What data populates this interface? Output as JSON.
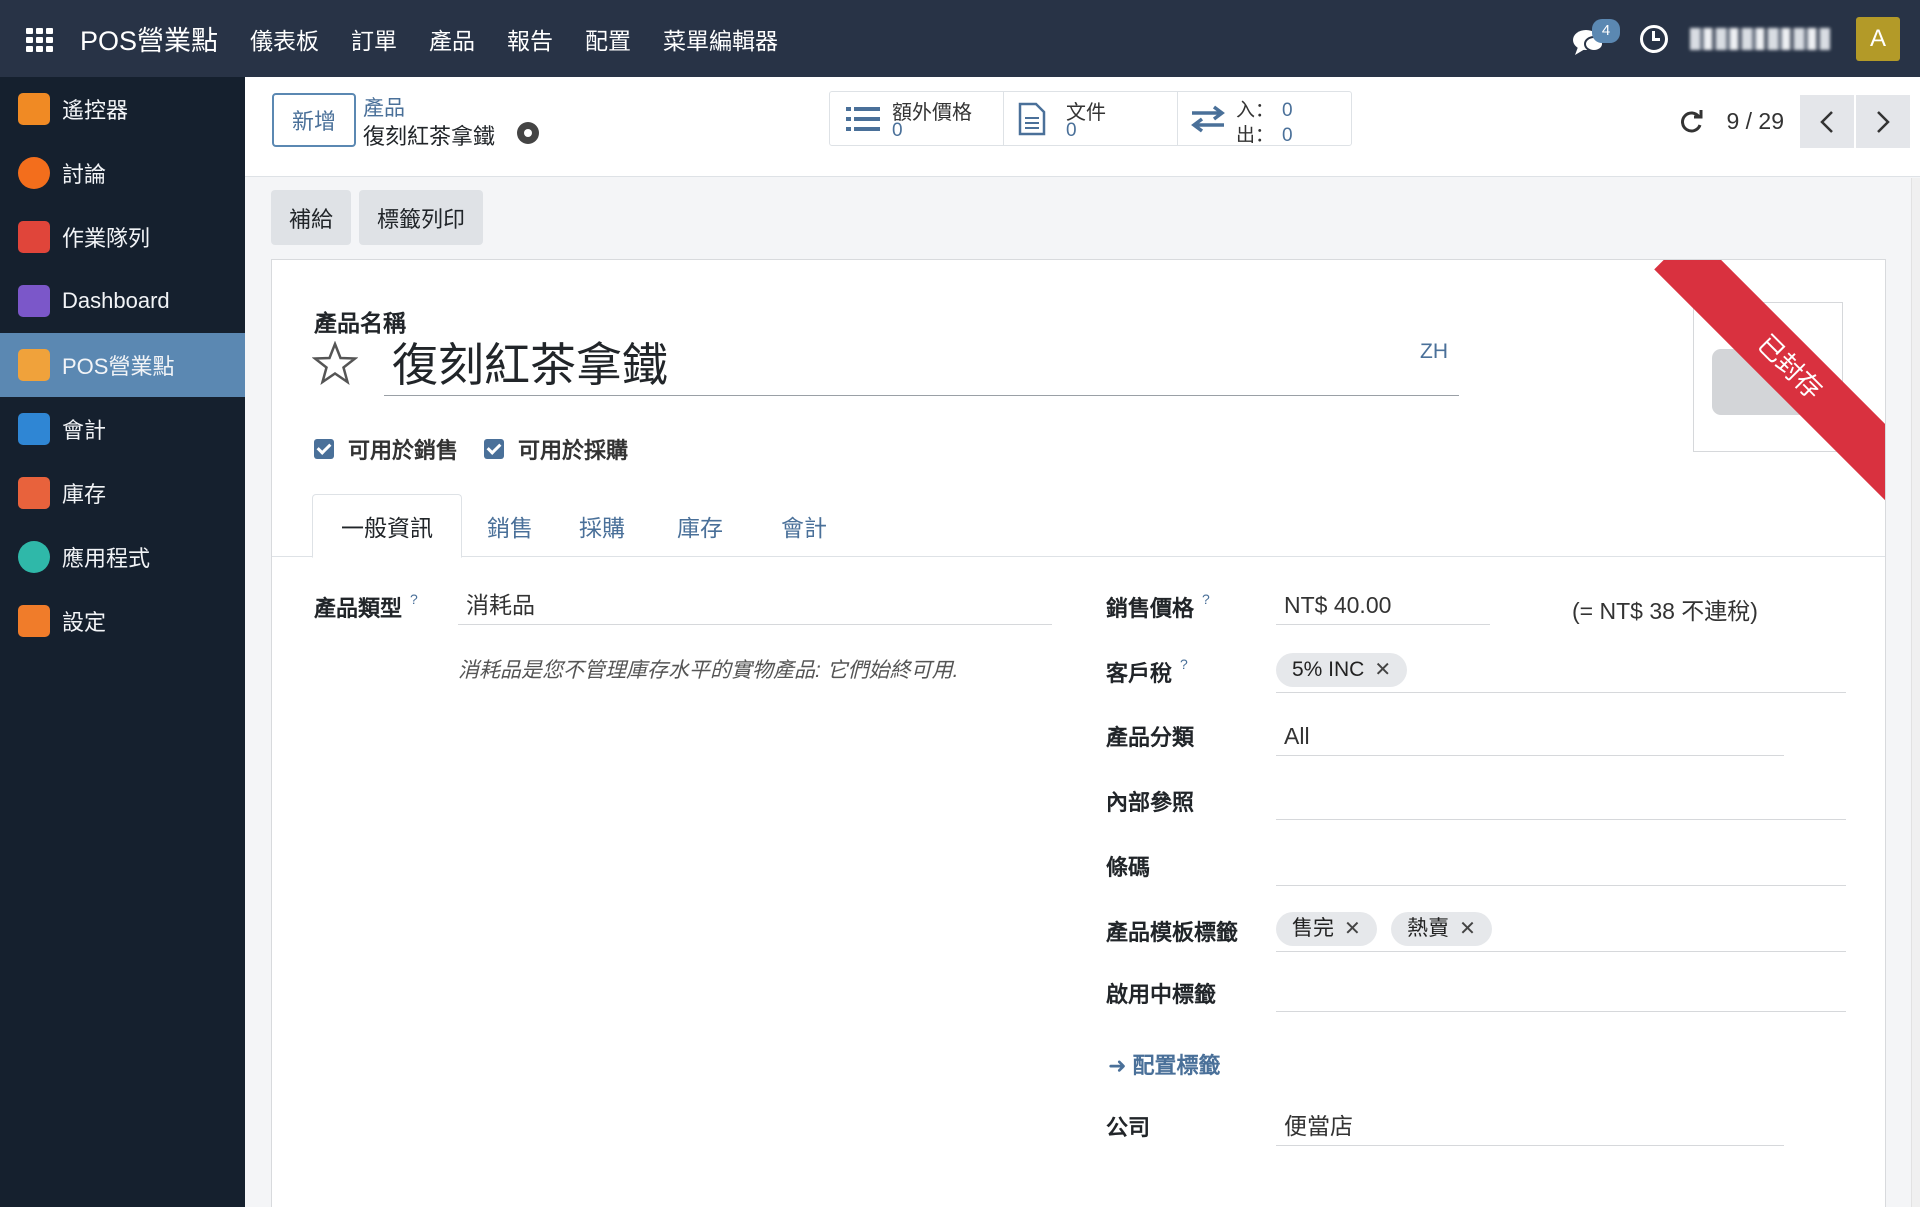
{
  "topbar": {
    "brand": "POS營業點",
    "menu": [
      "儀表板",
      "訂單",
      "產品",
      "報告",
      "配置",
      "菜單編輯器"
    ],
    "chat_count": "4",
    "avatar_letter": "A"
  },
  "sidebar": {
    "items": [
      {
        "label": "遙控器",
        "icon": "remote-icon",
        "color": "#f08a24"
      },
      {
        "label": "討論",
        "icon": "discuss-icon",
        "color": "#f36e1c"
      },
      {
        "label": "作業隊列",
        "icon": "queue-icon",
        "color": "#e0453a"
      },
      {
        "label": "Dashboard",
        "icon": "dashboard-icon",
        "color": "#7b57c9"
      },
      {
        "label": "POS營業點",
        "icon": "pos-icon",
        "color": "#f0a23b"
      },
      {
        "label": "會計",
        "icon": "accounting-icon",
        "color": "#2f86d4"
      },
      {
        "label": "庫存",
        "icon": "inventory-icon",
        "color": "#e8623c"
      },
      {
        "label": "應用程式",
        "icon": "apps-icon",
        "color": "#2fb8a9"
      },
      {
        "label": "設定",
        "icon": "settings-icon",
        "color": "#f07c2a"
      }
    ],
    "active_index": 4
  },
  "control": {
    "new_label": "新增",
    "breadcrumb_parent": "產品",
    "breadcrumb_current": "復刻紅茶拿鐵",
    "stats": {
      "extra_price_label": "額外價格",
      "extra_price_value": "0",
      "documents_label": "文件",
      "documents_value": "0",
      "in_label": "入：",
      "in_value": "0",
      "out_label": "出：",
      "out_value": "0"
    },
    "pager": "9 / 29"
  },
  "actions": {
    "replenish": "補給",
    "print_labels": "標籤列印"
  },
  "form": {
    "archived_ribbon": "已封存",
    "name_label": "產品名稱",
    "name_value": "復刻紅茶拿鐵",
    "lang": "ZH",
    "can_be_sold": "可用於銷售",
    "can_be_purchased": "可用於採購",
    "tabs": [
      "一般資訊",
      "銷售",
      "採購",
      "庫存",
      "會計"
    ],
    "active_tab": 0,
    "product_type_label": "產品類型",
    "product_type_value": "消耗品",
    "product_type_note": "消耗品是您不管理庫存水平的實物產品: 它們始終可用.",
    "sales_price_label": "銷售價格",
    "sales_price_value": "NT$ 40.00",
    "sales_price_tax_note": "(= NT$ 38 不連稅)",
    "customer_taxes_label": "客戶稅",
    "customer_taxes_tags": [
      "5% INC"
    ],
    "category_label": "產品分類",
    "category_value": "All",
    "internal_ref_label": "內部參照",
    "internal_ref_value": "",
    "barcode_label": "條碼",
    "barcode_value": "",
    "template_tags_label": "產品模板標籤",
    "template_tags": [
      "售完",
      "熱賣"
    ],
    "active_tags_label": "啟用中標籤",
    "configure_tags_link": "配置標籤",
    "company_label": "公司",
    "company_value": "便當店"
  },
  "colors": {
    "topbar": "#283346",
    "sidebar": "#15202e",
    "accent": "#4a7099",
    "ribbon": "#d9313f"
  }
}
